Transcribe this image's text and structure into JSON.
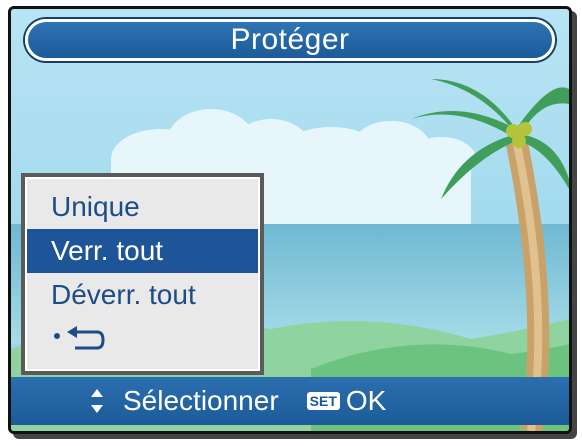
{
  "title": "Protéger",
  "menu": {
    "items": [
      {
        "label": "Unique",
        "selected": false
      },
      {
        "label": "Verr. tout",
        "selected": true
      },
      {
        "label": "Déverr. tout",
        "selected": false
      }
    ],
    "back_icon": "return-arrow-icon"
  },
  "footer": {
    "navigate_icon": "up-down-arrows-icon",
    "select_label": "Sélectionner",
    "set_badge": "SET",
    "ok_label": "OK"
  },
  "colors": {
    "accent": "#1e5598",
    "menu_text": "#1d4d86",
    "menu_bg": "#e9e9e9",
    "sky": "#9fd9ef",
    "sea": "#7fc4d6"
  }
}
